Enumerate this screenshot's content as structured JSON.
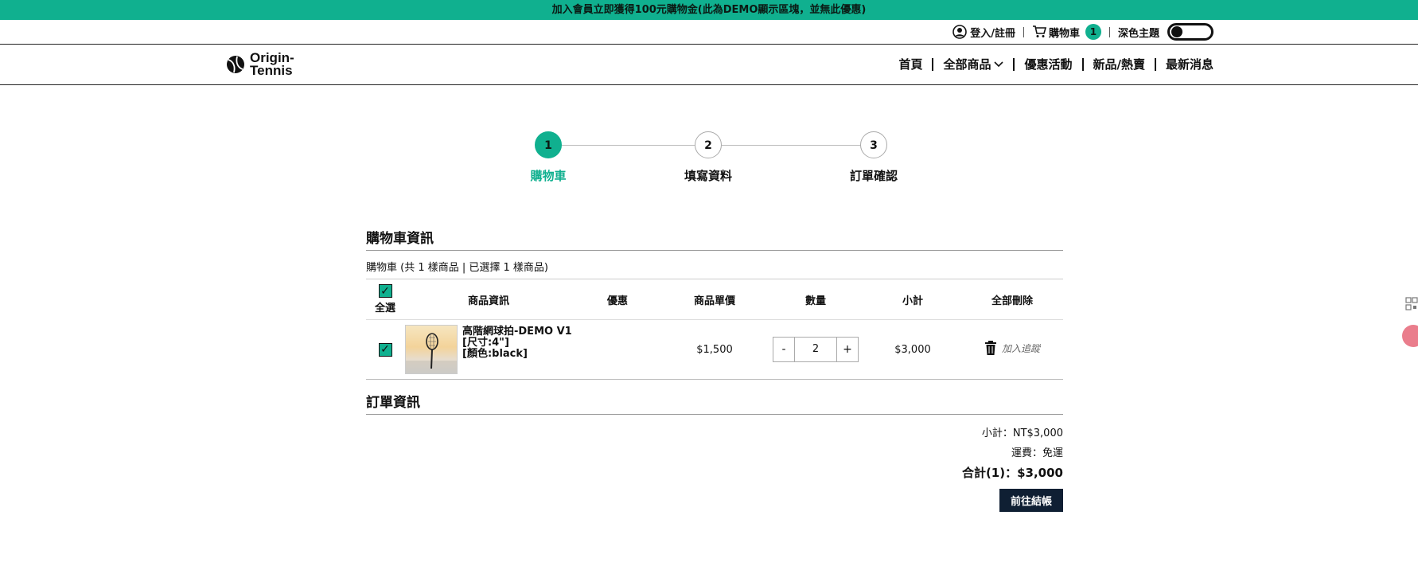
{
  "promo": {
    "text": "加入會員立即獲得100元購物金(此為DEMO顯示區塊，並無此優惠)"
  },
  "utility": {
    "login_label": "登入/註冊",
    "cart_label": "購物車",
    "cart_count": "1",
    "dark_theme_label": "深色主題"
  },
  "logo": {
    "line1": "Origin-",
    "line2": "Tennis"
  },
  "nav": {
    "home": "首頁",
    "all_products": "全部商品",
    "promotions": "優惠活動",
    "new_hot": "新品/熱賣",
    "news": "最新消息"
  },
  "steps": [
    {
      "number": "1",
      "label": "購物車"
    },
    {
      "number": "2",
      "label": "填寫資料"
    },
    {
      "number": "3",
      "label": "訂單確認"
    }
  ],
  "cart": {
    "title": "購物車資訊",
    "summary": "購物車 (共 1 樣商品 | 已選擇 1 樣商品)",
    "select_all_label": "全選",
    "columns": {
      "product": "商品資訊",
      "discount": "優惠",
      "unit_price": "商品單價",
      "quantity": "數量",
      "subtotal": "小計",
      "delete_all": "全部刪除"
    },
    "items": [
      {
        "name": "高階網球拍-DEMO V1",
        "size": "[尺寸:4\"]",
        "color": "[顏色:black]",
        "discount": "",
        "unit_price": "$1,500",
        "qty": "2",
        "subtotal": "$3,000",
        "track_label": "加入追蹤"
      }
    ]
  },
  "order": {
    "title": "訂單資訊",
    "subtotal": "小計：NT$3,000",
    "shipping": "運費：免運",
    "total": "合計(1)：$3,000",
    "checkout_label": "前往結帳"
  }
}
